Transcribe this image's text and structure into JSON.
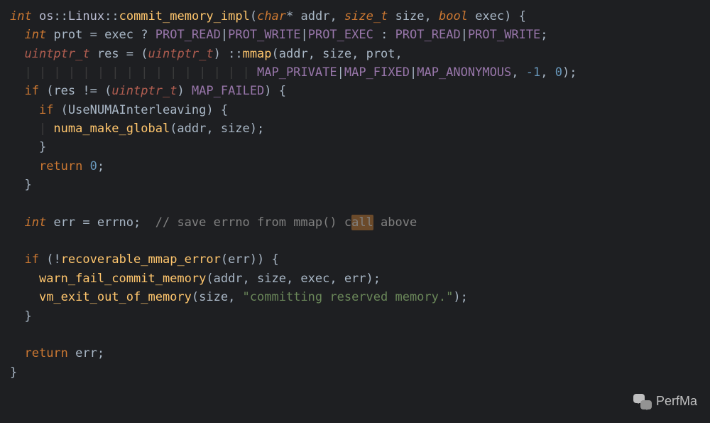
{
  "code": {
    "l1": {
      "t1": "int",
      "t2": " os",
      "t3": "::",
      "t4": "Linux",
      "t5": "::",
      "t6": "commit_memory_impl",
      "t7": "(",
      "t8": "char",
      "t9": "* addr, ",
      "t10": "size_t",
      "t11": " size, ",
      "t12": "bool",
      "t13": " exec) {"
    },
    "l2": {
      "indent": "  ",
      "t1": "int",
      "t2": " prot = exec ? ",
      "t3": "PROT_READ",
      "t4": "|",
      "t5": "PROT_WRITE",
      "t6": "|",
      "t7": "PROT_EXEC",
      "t8": " : ",
      "t9": "PROT_READ",
      "t10": "|",
      "t11": "PROT_WRITE",
      "t12": ";"
    },
    "l3": {
      "indent": "  ",
      "t1": "uintptr_t",
      "t2": " res = (",
      "t3": "uintptr_t",
      "t4": ") ::",
      "t5": "mmap",
      "t6": "(addr, size, prot,"
    },
    "l4": {
      "guides": "  | | | | | | | | | | | | | | | | ",
      "t1": "MAP_PRIVATE",
      "t2": "|",
      "t3": "MAP_FIXED",
      "t4": "|",
      "t5": "MAP_ANONYMOUS",
      "t6": ", ",
      "t7": "-1",
      "t8": ", ",
      "t9": "0",
      "t10": ");"
    },
    "l5": {
      "indent": "  ",
      "t1": "if",
      "t2": " (res != (",
      "t3": "uintptr_t",
      "t4": ") ",
      "t5": "MAP_FAILED",
      "t6": ") {"
    },
    "l6": {
      "indent": "    ",
      "t1": "if",
      "t2": " (UseNUMAInterleaving) {"
    },
    "l7": {
      "guides": "    | ",
      "t1": "numa_make_global",
      "t2": "(addr, size);"
    },
    "l8": {
      "indent": "    ",
      "t1": "}"
    },
    "l9": {
      "indent": "    ",
      "t1": "return",
      "t2": " ",
      "t3": "0",
      "t4": ";"
    },
    "l10": {
      "indent": "  ",
      "t1": "}"
    },
    "l11": {
      "blank": " "
    },
    "l12": {
      "indent": "  ",
      "t1": "int",
      "t2": " err = errno;  ",
      "t3": "// save errno from mmap() c",
      "t4": "all",
      "t5": " above"
    },
    "l13": {
      "blank": " "
    },
    "l14": {
      "indent": "  ",
      "t1": "if",
      "t2": " (!",
      "t3": "recoverable_mmap_error",
      "t4": "(err)) {"
    },
    "l15": {
      "indent": "    ",
      "t1": "warn_fail_commit_memory",
      "t2": "(addr, size, exec, err);"
    },
    "l16": {
      "indent": "    ",
      "t1": "vm_exit_out_of_memory",
      "t2": "(size, ",
      "t3": "\"committing reserved memory.\"",
      "t4": ");"
    },
    "l17": {
      "indent": "  ",
      "t1": "}"
    },
    "l18": {
      "blank": " "
    },
    "l19": {
      "indent": "  ",
      "t1": "return",
      "t2": " err;"
    },
    "l20": {
      "t1": "}"
    }
  },
  "watermark": {
    "label": "PerfMa"
  },
  "gutter_mark": "^"
}
